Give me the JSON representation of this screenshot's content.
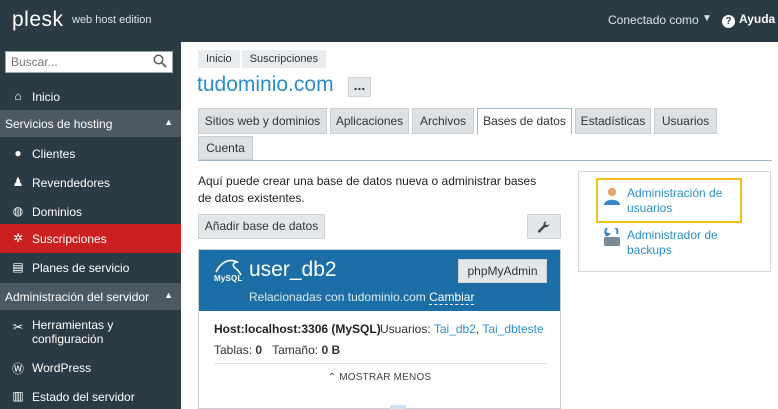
{
  "header": {
    "logo": "plesk",
    "edition": "web host edition",
    "user_menu": "Conectado como",
    "help": "Ayuda"
  },
  "sidebar": {
    "search_placeholder": "Buscar...",
    "home": "Inicio",
    "section_hosting": "Servicios de hosting",
    "items_hosting": [
      "Clientes",
      "Revendedores",
      "Dominios",
      "Suscripciones",
      "Planes de servicio"
    ],
    "section_server": "Administración del servidor",
    "items_server": [
      "Herramientas y configuración",
      "WordPress",
      "Estado del servidor"
    ],
    "active": "Suscripciones"
  },
  "breadcrumb": [
    "Inicio",
    "Suscripciones"
  ],
  "page_title": "tudominio.com",
  "more_label": "...",
  "tabs": [
    "Sitios web y dominios",
    "Aplicaciones",
    "Archivos",
    "Bases de datos",
    "Estadísticas",
    "Usuarios",
    "Cuenta"
  ],
  "active_tab": "Bases de datos",
  "intro": "Aquí puede crear una base de datos nueva o administrar bases de datos existentes.",
  "add_db_label": "Añadir base de datos",
  "database": {
    "engine_label": "MySQL",
    "name": "user_db2",
    "related_prefix": "Relacionadas con tudominio.com",
    "change_label": "Cambiar",
    "phpmyadmin_label": "phpMyAdmin",
    "host_label": "Host:",
    "host_value": "localhost:3306 (MySQL)",
    "users_label": "Usuarios:",
    "users": [
      "Tai_db2",
      "Tai_dbteste"
    ],
    "tables_label": "Tablas:",
    "tables_value": "0",
    "size_label": "Tamaño:",
    "size_value": "0 B",
    "show_less_label": "MOSTRAR MENOS"
  },
  "side_links": {
    "user_admin": "Administración de usuarios",
    "backup_admin": "Administrador de backups"
  },
  "colors": {
    "header_bg": "#2a3b46",
    "active_nav": "#cc1f1f",
    "link": "#2b8ec9",
    "db_header": "#1b6fa6",
    "highlight": "#f2c21b"
  }
}
